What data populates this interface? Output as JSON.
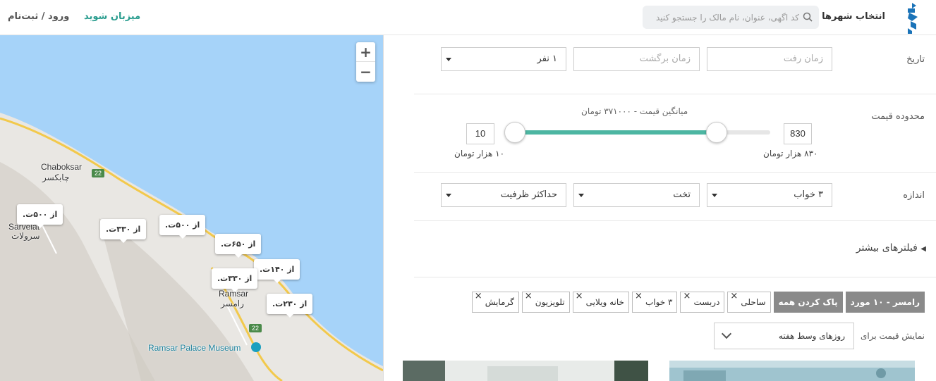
{
  "header": {
    "city_select": "انتخاب شهرها",
    "search_placeholder": "کد اگهی، عنوان، نام مالک را جستجو کنید",
    "host_link": "میزبان شوید",
    "login_link": "ورود / ثبت‌نام"
  },
  "map": {
    "zoom_in": "+",
    "zoom_out": "−",
    "places": {
      "chaboksar_en": "Chaboksar",
      "chaboksar_fa": "چابکسر",
      "sarvelat_en": "Sarvelat",
      "sarvelat_fa": "سرولات",
      "ramsar_en": "Ramsar",
      "ramsar_fa": "رامسر",
      "museum": "Ramsar Palace Museum",
      "road_22_a": "22",
      "road_22_b": "22"
    },
    "pins": [
      "از ۵۰۰ت.",
      "از ۳۳۰ت.",
      "از ۵۰۰ت.",
      "از ۶۵۰ت.",
      "از ۱۴۰ت.",
      "از ۳۳۰ت.",
      "از ۲۳۰ت."
    ]
  },
  "filters": {
    "date_label": "تاریخ",
    "departure_placeholder": "زمان رفت",
    "return_placeholder": "زمان برگشت",
    "guests_value": "۱ نفر",
    "price_label": "محدوده قیمت",
    "avg_price": "میانگین قیمت - ۳۷۱۰۰۰ تومان",
    "max_value": "830",
    "min_value": "10",
    "max_label": "۸۳۰ هزار تومان",
    "min_label": "۱۰ هزار تومان",
    "slider_fill_fraction": 0.79,
    "size_label": "اندازه",
    "bedrooms_value": "۳ خواب",
    "bed_value": "تخت",
    "capacity_value": "حداکثر ظرفیت",
    "more_filters": "فیلترهای بیشتر"
  },
  "chips": {
    "summary": "رامسر - ۱۰ مورد",
    "clear_all": "پاک کردن همه",
    "items": [
      "ساحلی",
      "دربست",
      "۳ خواب",
      "خانه ویلایی",
      "تلویزیون",
      "گرمایش"
    ]
  },
  "price_display": {
    "label": "نمایش قیمت برای",
    "value": "روزهای وسط هفته"
  },
  "colors": {
    "accent": "#4db6a2",
    "brand": "#1a73b8",
    "water": "#a6d3f9"
  }
}
